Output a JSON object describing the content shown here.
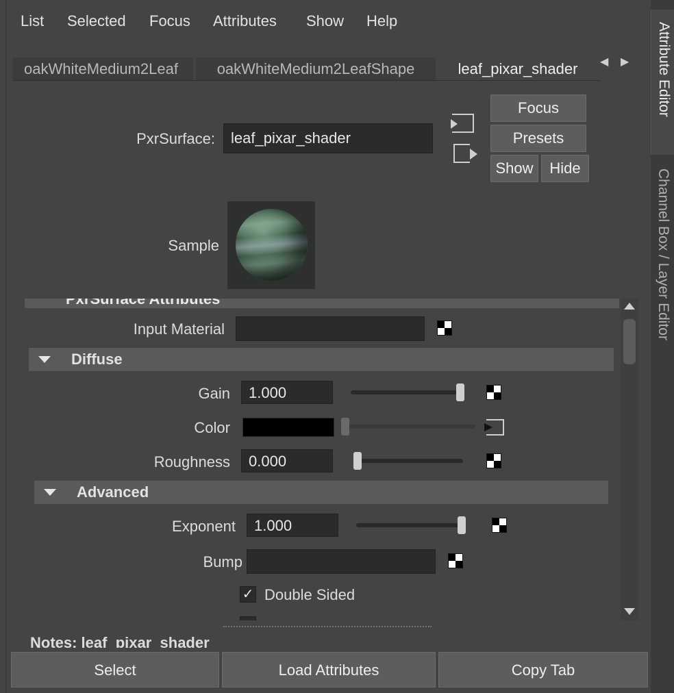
{
  "menu": [
    "List",
    "Selected",
    "Focus",
    "Attributes",
    "Show",
    "Help"
  ],
  "tabs": [
    {
      "label": "oakWhiteMedium2Leaf"
    },
    {
      "label": "oakWhiteMedium2LeafShape"
    },
    {
      "label": "leaf_pixar_shader",
      "active": true
    }
  ],
  "header": {
    "node_type_label": "PxrSurface:",
    "node_name": "leaf_pixar_shader",
    "focus_label": "Focus",
    "presets_label": "Presets",
    "show_label": "Show",
    "hide_label": "Hide",
    "sample_label": "Sample"
  },
  "attributes": {
    "section_title": "PxrSurface Attributes",
    "input_material_label": "Input Material",
    "diffuse": {
      "title": "Diffuse",
      "gain_label": "Gain",
      "gain_value": "1.000",
      "gain_slider": 1.0,
      "color_label": "Color",
      "color_value": "#000000",
      "roughness_label": "Roughness",
      "roughness_value": "0.000",
      "roughness_slider": 0.0
    },
    "advanced": {
      "title": "Advanced",
      "exponent_label": "Exponent",
      "exponent_value": "1.000",
      "exponent_slider": 1.0,
      "bump_label": "Bump",
      "double_sided_label": "Double Sided",
      "double_sided_checked": true
    }
  },
  "notes": "Notes:  leaf_pixar_shader",
  "bottom_buttons": [
    "Select",
    "Load Attributes",
    "Copy Tab"
  ],
  "side_tabs": [
    "Attribute Editor",
    "Channel Box / Layer Editor"
  ]
}
